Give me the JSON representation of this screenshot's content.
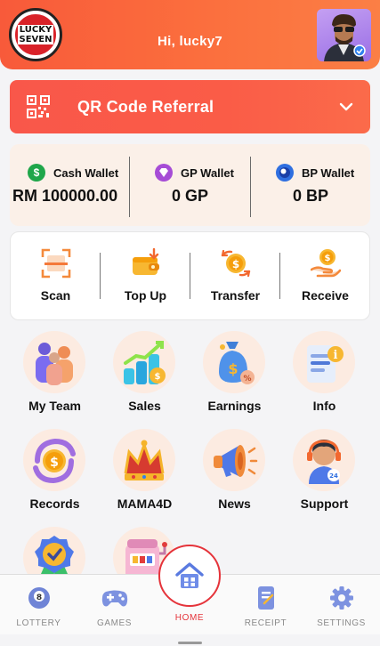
{
  "header": {
    "logo_line1": "LUCKY",
    "logo_line2": "SEVEN",
    "greeting": "Hi,  lucky7"
  },
  "referral": {
    "title": "QR Code Referral"
  },
  "wallets": [
    {
      "label": "Cash Wallet",
      "amount": "RM 100000.00",
      "icon": "dollar-circle-icon",
      "color": "#1fa64a"
    },
    {
      "label": "GP Wallet",
      "amount": "0 GP",
      "icon": "gem-icon",
      "color": "#a64cd6"
    },
    {
      "label": "BP Wallet",
      "amount": "0 BP",
      "icon": "billiard-ball-icon",
      "color": "#2f6fe0"
    }
  ],
  "actions": [
    {
      "label": "Scan",
      "icon": "scan-icon"
    },
    {
      "label": "Top Up",
      "icon": "wallet-topup-icon"
    },
    {
      "label": "Transfer",
      "icon": "coin-transfer-icon"
    },
    {
      "label": "Receive",
      "icon": "hand-coin-icon"
    }
  ],
  "menu": [
    {
      "label": "My Team",
      "icon": "team-icon"
    },
    {
      "label": "Sales",
      "icon": "sales-chart-icon"
    },
    {
      "label": "Earnings",
      "icon": "money-bag-icon"
    },
    {
      "label": "Info",
      "icon": "info-document-icon"
    },
    {
      "label": "Records",
      "icon": "coin-records-icon"
    },
    {
      "label": "MAMA4D",
      "icon": "crown-icon"
    },
    {
      "label": "News",
      "icon": "megaphone-icon"
    },
    {
      "label": "Support",
      "icon": "support-agent-icon"
    },
    {
      "label": "",
      "icon": "badge-check-icon"
    },
    {
      "label": "",
      "icon": "slot-machine-icon"
    }
  ],
  "nav": {
    "lottery": "LOTTERY",
    "games": "GAMES",
    "home": "HOME",
    "receipt": "RECEIPT",
    "settings": "SETTINGS",
    "active": "HOME",
    "accent": "#e5333a"
  }
}
